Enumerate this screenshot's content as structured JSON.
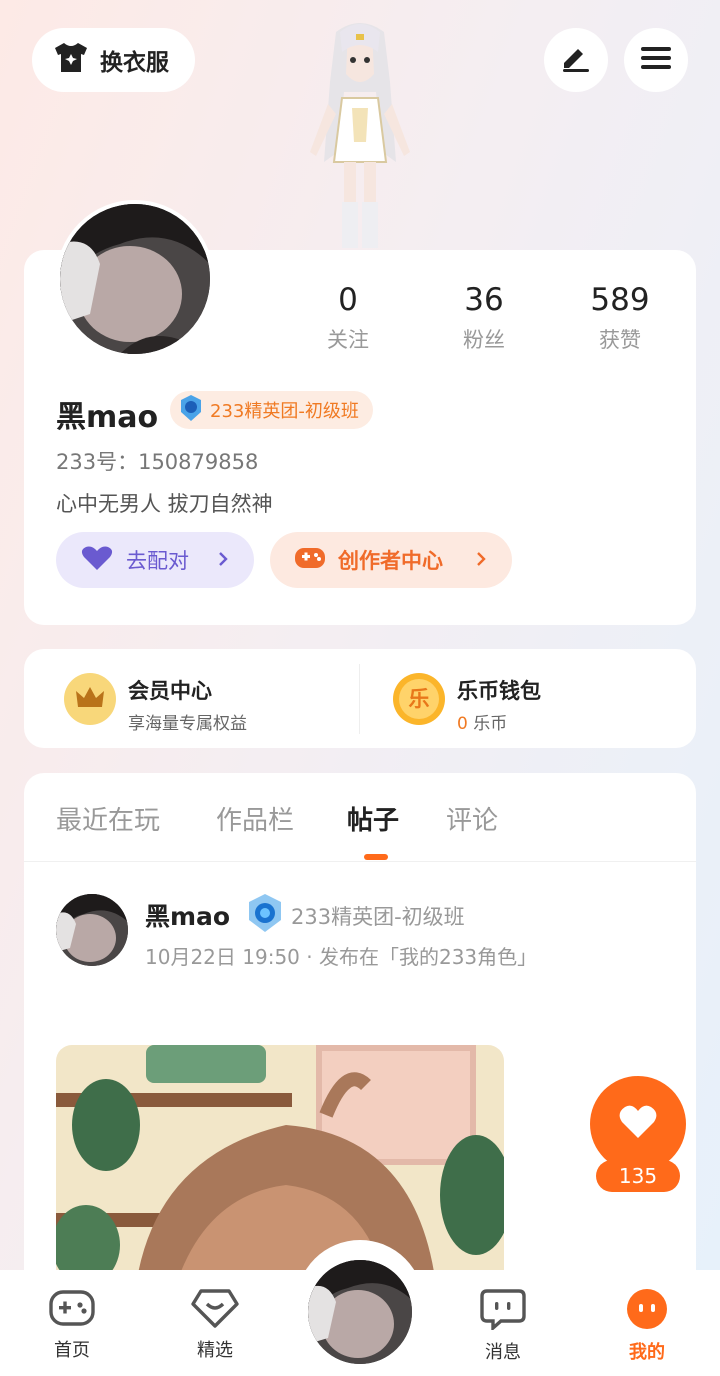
{
  "header": {
    "outfit_label": "换衣服",
    "edit_icon": "pen-icon",
    "menu_icon": "menu-icon"
  },
  "profile": {
    "stats": [
      {
        "value": "0",
        "label": "关注"
      },
      {
        "value": "36",
        "label": "粉丝"
      },
      {
        "value": "589",
        "label": "获赞"
      }
    ],
    "username": "黑mao",
    "badge": "233精英团-初级班",
    "uid": "233号：150879858",
    "bio": "心中无男人  拔刀自然神",
    "buttons": {
      "pair": "去配对",
      "creator": "创作者中心"
    }
  },
  "member": {
    "vip_title": "会员中心",
    "vip_sub": "享海量专属权益",
    "wallet_title": "乐币钱包",
    "wallet_amount": "0",
    "wallet_unit": "乐币",
    "coin_glyph": "乐"
  },
  "tabs": [
    "最近在玩",
    "作品栏",
    "帖子",
    "评论"
  ],
  "active_tab": "帖子",
  "post": {
    "author": "黑mao",
    "badge": "233精英团-初级班",
    "meta": "10月22日 19:50 · 发布在「我的233角色」"
  },
  "like": {
    "count": "135"
  },
  "bottom_nav": [
    {
      "label": "首页",
      "icon": "gamepad-icon"
    },
    {
      "label": "精选",
      "icon": "heart-chat-icon"
    },
    {
      "label": "",
      "icon": "avatar"
    },
    {
      "label": "消息",
      "icon": "message-icon"
    },
    {
      "label": "我的",
      "icon": "me-icon"
    }
  ],
  "colors": {
    "accent": "#ff6a1a",
    "badge_text": "#f07a23",
    "pair_bg": "#ebe8fb",
    "pair_text": "#6a5ad0"
  }
}
